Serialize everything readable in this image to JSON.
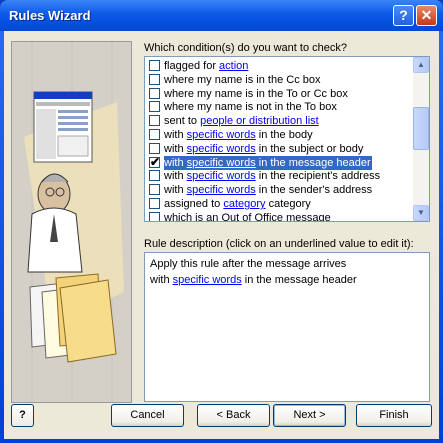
{
  "window": {
    "title": "Rules Wizard",
    "help_icon": "help-icon",
    "close_icon": "close-icon"
  },
  "conditions": {
    "heading": "Which condition(s) do you want to check?",
    "items": [
      {
        "pre": "flagged for ",
        "link": "action",
        "post": "",
        "checked": false
      },
      {
        "pre": "where my name is in the Cc box",
        "link": "",
        "post": "",
        "checked": false
      },
      {
        "pre": "where my name is in the To or Cc box",
        "link": "",
        "post": "",
        "checked": false
      },
      {
        "pre": "where my name is not in the To box",
        "link": "",
        "post": "",
        "checked": false
      },
      {
        "pre": "sent to ",
        "link": "people or distribution list",
        "post": "",
        "checked": false
      },
      {
        "pre": "with ",
        "link": "specific words",
        "post": " in the body",
        "checked": false
      },
      {
        "pre": "with ",
        "link": "specific words",
        "post": " in the subject or body",
        "checked": false
      },
      {
        "pre": "with ",
        "link": "specific words",
        "post": " in the message header",
        "checked": true
      },
      {
        "pre": "with ",
        "link": "specific words",
        "post": " in the recipient's address",
        "checked": false
      },
      {
        "pre": "with ",
        "link": "specific words",
        "post": " in the sender's address",
        "checked": false
      },
      {
        "pre": "assigned to ",
        "link": "category",
        "post": " category",
        "checked": false
      },
      {
        "pre": "which is an Out of Office message",
        "link": "",
        "post": "",
        "checked": false
      }
    ],
    "selected_index": 7
  },
  "description": {
    "heading": "Rule description (click on an underlined value to edit it):",
    "line1": "Apply this rule after the message arrives",
    "line2_pre": "with ",
    "line2_link": "specific words",
    "line2_post": " in the message header"
  },
  "buttons": {
    "help": "?",
    "cancel": "Cancel",
    "back": "< Back",
    "next": "Next >",
    "finish": "Finish"
  },
  "colors": {
    "titlebar": "#0c5ae6",
    "selection": "#316ac5",
    "link": "#0000ff",
    "dialog_bg": "#ece9d8"
  }
}
